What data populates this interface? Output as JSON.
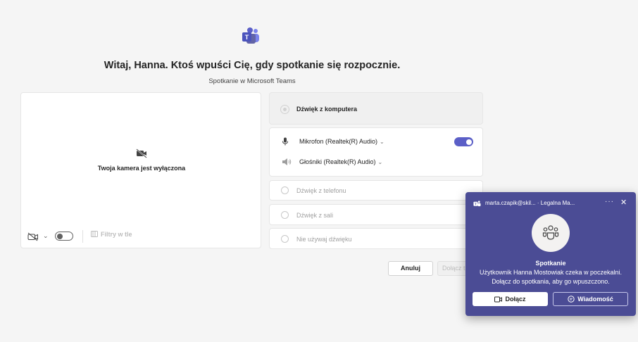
{
  "header": {
    "app_icon": "teams-logo-icon",
    "greeting": "Witaj, Hanna. Ktoś wpuści Cię, gdy spotkanie się rozpocznie.",
    "subtitle": "Spotkanie w Microsoft Teams"
  },
  "camera": {
    "status_icon": "camera-off-icon",
    "status_text": "Twoja kamera jest wyłączona",
    "controls": {
      "camera_icon": "camera-off-icon",
      "camera_toggle_on": false,
      "filters_label": "Filtry w tle"
    }
  },
  "audio": {
    "options": [
      {
        "label": "Dźwięk z komputera",
        "selected": true
      },
      {
        "label": "Dźwięk z telefonu",
        "selected": false
      },
      {
        "label": "Dźwięk z sali",
        "selected": false
      },
      {
        "label": "Nie używaj dźwięku",
        "selected": false
      }
    ],
    "microphone": {
      "label": "Mikrofon (Realtek(R) Audio)",
      "enabled": true
    },
    "speakers": {
      "label": "Głośniki (Realtek(R) Audio)"
    }
  },
  "actions": {
    "cancel_label": "Anuluj",
    "join_label": "Dołącz teraz"
  },
  "notification": {
    "header": "marta.czapik@skil... · Legalna Ma...",
    "more_label": "···",
    "close_label": "✕",
    "title": "Spotkanie",
    "line1": "Użytkownik Hanna Mostowiak czeka w poczekalni.",
    "line2": "Dołącz do spotkania, aby go wpuszczono.",
    "join_label": "Dołącz",
    "message_label": "Wiadomość"
  },
  "colors": {
    "accent": "#5b5fc7",
    "toast_background": "#4b4c95",
    "page_background": "#f5f5f5"
  }
}
